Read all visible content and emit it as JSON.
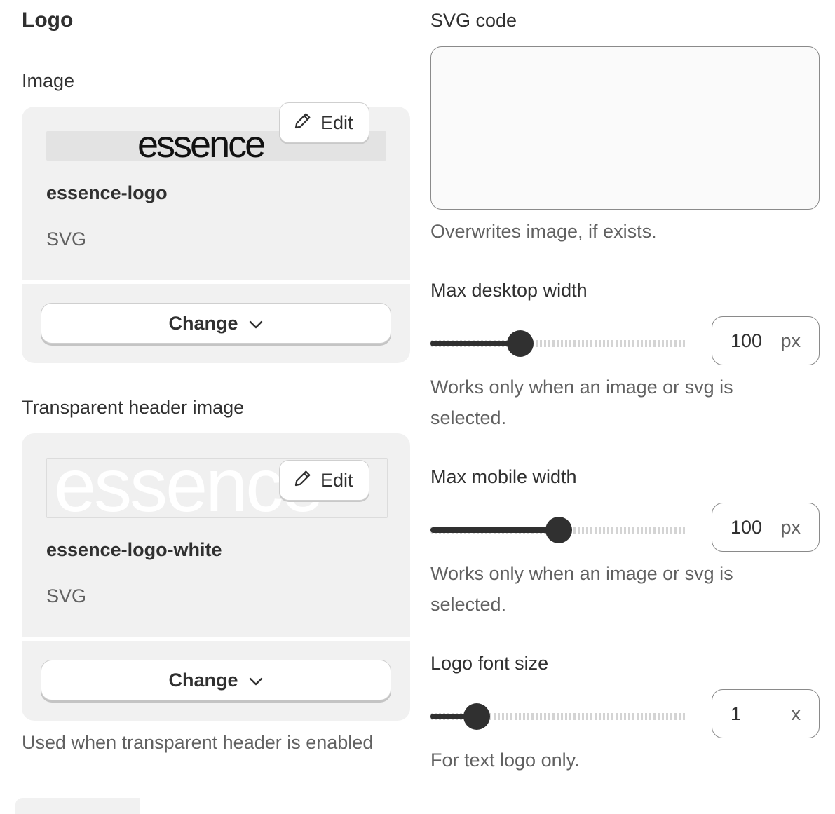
{
  "left": {
    "section_title": "Logo",
    "image_label": "Image",
    "image_card": {
      "logo_text": "essence",
      "edit_label": "Edit",
      "file_name": "essence-logo",
      "file_type": "SVG",
      "change_label": "Change"
    },
    "transparent_label": "Transparent header image",
    "transparent_card": {
      "logo_text": "essence",
      "edit_label": "Edit",
      "file_name": "essence-logo-white",
      "file_type": "SVG",
      "change_label": "Change"
    },
    "transparent_help": "Used when transparent header is enabled"
  },
  "right": {
    "svg_label": "SVG code",
    "svg_value": "",
    "svg_help": "Overwrites image, if exists.",
    "desktop": {
      "label": "Max desktop width",
      "value": "100",
      "unit": "px",
      "slider_fraction": 0.35,
      "help": "Works only when an image or svg is selected."
    },
    "mobile": {
      "label": "Max mobile width",
      "value": "100",
      "unit": "px",
      "slider_fraction": 0.5,
      "help": "Works only when an image or svg is selected."
    },
    "font_size": {
      "label": "Logo font size",
      "value": "1",
      "unit": "x",
      "slider_fraction": 0.18,
      "help": "For text logo only."
    }
  }
}
